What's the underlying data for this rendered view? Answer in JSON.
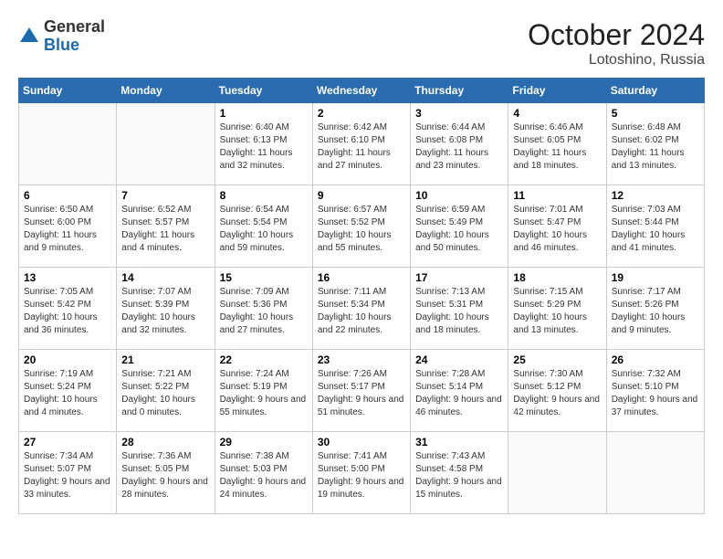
{
  "header": {
    "logo_general": "General",
    "logo_blue": "Blue",
    "month": "October 2024",
    "location": "Lotoshino, Russia"
  },
  "days_of_week": [
    "Sunday",
    "Monday",
    "Tuesday",
    "Wednesday",
    "Thursday",
    "Friday",
    "Saturday"
  ],
  "weeks": [
    [
      {
        "num": "",
        "info": ""
      },
      {
        "num": "",
        "info": ""
      },
      {
        "num": "1",
        "info": "Sunrise: 6:40 AM\nSunset: 6:13 PM\nDaylight: 11 hours and 32 minutes."
      },
      {
        "num": "2",
        "info": "Sunrise: 6:42 AM\nSunset: 6:10 PM\nDaylight: 11 hours and 27 minutes."
      },
      {
        "num": "3",
        "info": "Sunrise: 6:44 AM\nSunset: 6:08 PM\nDaylight: 11 hours and 23 minutes."
      },
      {
        "num": "4",
        "info": "Sunrise: 6:46 AM\nSunset: 6:05 PM\nDaylight: 11 hours and 18 minutes."
      },
      {
        "num": "5",
        "info": "Sunrise: 6:48 AM\nSunset: 6:02 PM\nDaylight: 11 hours and 13 minutes."
      }
    ],
    [
      {
        "num": "6",
        "info": "Sunrise: 6:50 AM\nSunset: 6:00 PM\nDaylight: 11 hours and 9 minutes."
      },
      {
        "num": "7",
        "info": "Sunrise: 6:52 AM\nSunset: 5:57 PM\nDaylight: 11 hours and 4 minutes."
      },
      {
        "num": "8",
        "info": "Sunrise: 6:54 AM\nSunset: 5:54 PM\nDaylight: 10 hours and 59 minutes."
      },
      {
        "num": "9",
        "info": "Sunrise: 6:57 AM\nSunset: 5:52 PM\nDaylight: 10 hours and 55 minutes."
      },
      {
        "num": "10",
        "info": "Sunrise: 6:59 AM\nSunset: 5:49 PM\nDaylight: 10 hours and 50 minutes."
      },
      {
        "num": "11",
        "info": "Sunrise: 7:01 AM\nSunset: 5:47 PM\nDaylight: 10 hours and 46 minutes."
      },
      {
        "num": "12",
        "info": "Sunrise: 7:03 AM\nSunset: 5:44 PM\nDaylight: 10 hours and 41 minutes."
      }
    ],
    [
      {
        "num": "13",
        "info": "Sunrise: 7:05 AM\nSunset: 5:42 PM\nDaylight: 10 hours and 36 minutes."
      },
      {
        "num": "14",
        "info": "Sunrise: 7:07 AM\nSunset: 5:39 PM\nDaylight: 10 hours and 32 minutes."
      },
      {
        "num": "15",
        "info": "Sunrise: 7:09 AM\nSunset: 5:36 PM\nDaylight: 10 hours and 27 minutes."
      },
      {
        "num": "16",
        "info": "Sunrise: 7:11 AM\nSunset: 5:34 PM\nDaylight: 10 hours and 22 minutes."
      },
      {
        "num": "17",
        "info": "Sunrise: 7:13 AM\nSunset: 5:31 PM\nDaylight: 10 hours and 18 minutes."
      },
      {
        "num": "18",
        "info": "Sunrise: 7:15 AM\nSunset: 5:29 PM\nDaylight: 10 hours and 13 minutes."
      },
      {
        "num": "19",
        "info": "Sunrise: 7:17 AM\nSunset: 5:26 PM\nDaylight: 10 hours and 9 minutes."
      }
    ],
    [
      {
        "num": "20",
        "info": "Sunrise: 7:19 AM\nSunset: 5:24 PM\nDaylight: 10 hours and 4 minutes."
      },
      {
        "num": "21",
        "info": "Sunrise: 7:21 AM\nSunset: 5:22 PM\nDaylight: 10 hours and 0 minutes."
      },
      {
        "num": "22",
        "info": "Sunrise: 7:24 AM\nSunset: 5:19 PM\nDaylight: 9 hours and 55 minutes."
      },
      {
        "num": "23",
        "info": "Sunrise: 7:26 AM\nSunset: 5:17 PM\nDaylight: 9 hours and 51 minutes."
      },
      {
        "num": "24",
        "info": "Sunrise: 7:28 AM\nSunset: 5:14 PM\nDaylight: 9 hours and 46 minutes."
      },
      {
        "num": "25",
        "info": "Sunrise: 7:30 AM\nSunset: 5:12 PM\nDaylight: 9 hours and 42 minutes."
      },
      {
        "num": "26",
        "info": "Sunrise: 7:32 AM\nSunset: 5:10 PM\nDaylight: 9 hours and 37 minutes."
      }
    ],
    [
      {
        "num": "27",
        "info": "Sunrise: 7:34 AM\nSunset: 5:07 PM\nDaylight: 9 hours and 33 minutes."
      },
      {
        "num": "28",
        "info": "Sunrise: 7:36 AM\nSunset: 5:05 PM\nDaylight: 9 hours and 28 minutes."
      },
      {
        "num": "29",
        "info": "Sunrise: 7:38 AM\nSunset: 5:03 PM\nDaylight: 9 hours and 24 minutes."
      },
      {
        "num": "30",
        "info": "Sunrise: 7:41 AM\nSunset: 5:00 PM\nDaylight: 9 hours and 19 minutes."
      },
      {
        "num": "31",
        "info": "Sunrise: 7:43 AM\nSunset: 4:58 PM\nDaylight: 9 hours and 15 minutes."
      },
      {
        "num": "",
        "info": ""
      },
      {
        "num": "",
        "info": ""
      }
    ]
  ]
}
